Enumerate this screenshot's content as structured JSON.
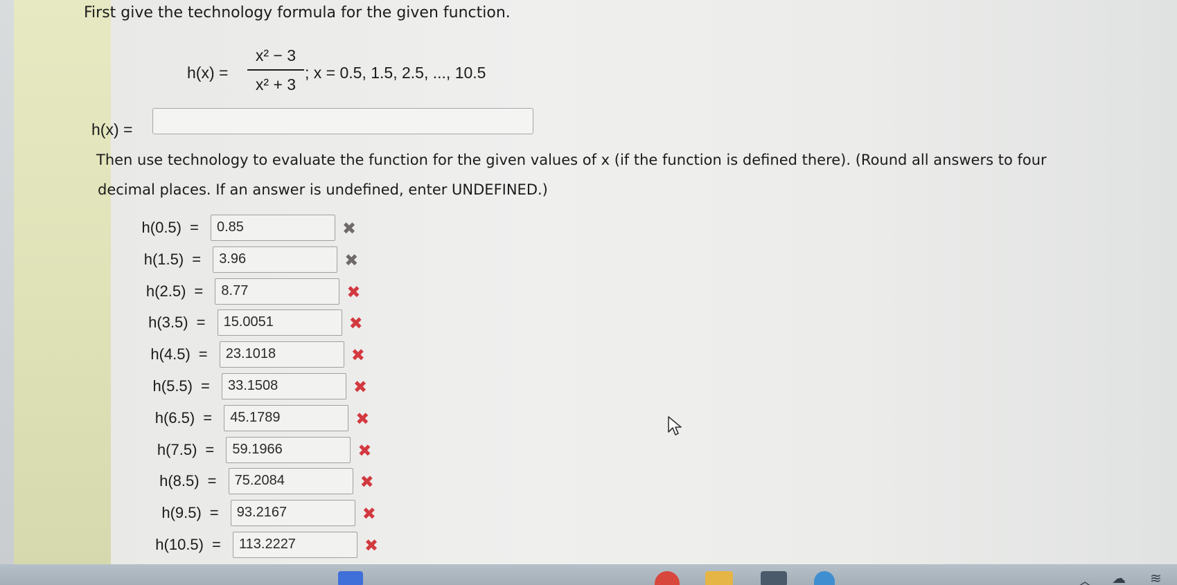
{
  "question": {
    "intro": "First give the technology formula for the given function.",
    "function_label": "h(x) =",
    "numerator": "x² − 3",
    "denominator": "x² + 3",
    "domain_text": "; x = 0.5, 1.5, 2.5, ..., 10.5",
    "formula_input_label": "h(x) =",
    "formula_input_value": "",
    "instructions_line1": "Then use technology to evaluate the function for the given values of x (if the function is defined there). (Round all answers to four",
    "instructions_line2": "decimal places. If an answer is undefined, enter UNDEFINED.)"
  },
  "rows": [
    {
      "label": "h(0.5)",
      "value": "0.85",
      "mark": "✖"
    },
    {
      "label": "h(1.5)",
      "value": "3.96",
      "mark": "✖"
    },
    {
      "label": "h(2.5)",
      "value": "8.77",
      "mark": "✖"
    },
    {
      "label": "h(3.5)",
      "value": "15.0051",
      "mark": "✖"
    },
    {
      "label": "h(4.5)",
      "value": "23.1018",
      "mark": "✖"
    },
    {
      "label": "h(5.5)",
      "value": "33.1508",
      "mark": "✖"
    },
    {
      "label": "h(6.5)",
      "value": "45.1789",
      "mark": "✖"
    },
    {
      "label": "h(7.5)",
      "value": "59.1966",
      "mark": "✖"
    },
    {
      "label": "h(8.5)",
      "value": "75.2084",
      "mark": "✖"
    },
    {
      "label": "h(9.5)",
      "value": "93.2167",
      "mark": "✖"
    },
    {
      "label": "h(10.5)",
      "value": "113.2227",
      "mark": "✖"
    }
  ],
  "equals_sign": "=",
  "colors": {
    "incorrect_mark_gray": "#6f6a6a",
    "incorrect_mark_red": "#d2393f",
    "sidebar_stripe": "#e3e5bb"
  },
  "icons": {
    "incorrect": "x-mark-icon",
    "cursor": "mouse-pointer-icon"
  }
}
